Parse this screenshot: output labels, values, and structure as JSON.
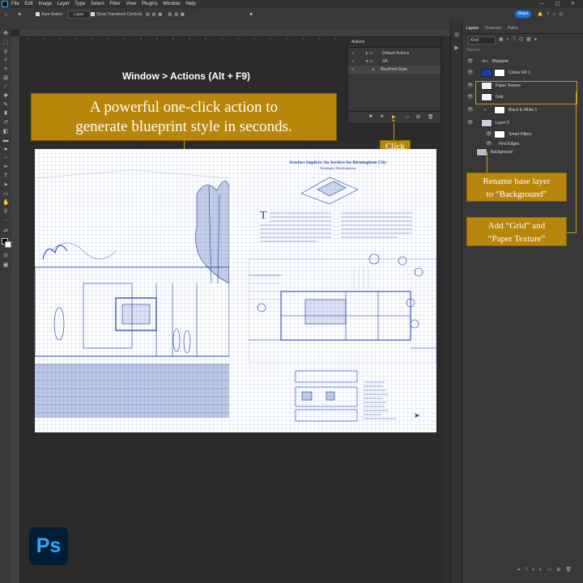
{
  "menu": {
    "items": [
      "File",
      "Edit",
      "Image",
      "Layer",
      "Type",
      "Select",
      "Filter",
      "View",
      "Plugins",
      "Window",
      "Help"
    ],
    "window_controls": "— ▢ ✕"
  },
  "options_bar": {
    "auto_select_label": "Auto-Select",
    "auto_select_value": "Layer",
    "show_transform_label": "Show Transform Controls",
    "share_label": "Share"
  },
  "callouts": {
    "window_path": "Window > Actions (Alt + F9)",
    "headline_line1": "A powerful one-click action to",
    "headline_line2": "generate blueprint style in seconds.",
    "click": "Click",
    "rename_line1": "Rename base layer",
    "rename_line2": "to “Background”",
    "add_line1": "Add “Grid” and",
    "add_line2": "“Paper Texture”"
  },
  "actions_panel": {
    "title": "Actions",
    "rows": [
      "Default Actions",
      "SA",
      "BluePrint Style"
    ]
  },
  "document": {
    "title": "Artefact Implicit: An Archive for Birmingham City",
    "subtitle": "Schematic Development",
    "drop_cap": "T"
  },
  "layers_panel": {
    "tabs": [
      "Layers",
      "Channels",
      "Paths"
    ],
    "kind_label": "Kind",
    "blend_label": "Normal",
    "layers": [
      {
        "name": "Blueprint"
      },
      {
        "name": "Colour Fill 1"
      },
      {
        "name": "Paper Texture"
      },
      {
        "name": "Grid"
      },
      {
        "name": "Black & White 1"
      },
      {
        "name": "Layer 0"
      },
      {
        "name": "Smart Filters"
      },
      {
        "name": "Find Edges"
      },
      {
        "name": "Background"
      }
    ]
  },
  "app_logo": "Ps",
  "colors": {
    "accent_gold": "#b8860b",
    "blueprint_blue": "#1a3fa8",
    "share_blue": "#1473e6",
    "ps_blue": "#31a8ff"
  }
}
